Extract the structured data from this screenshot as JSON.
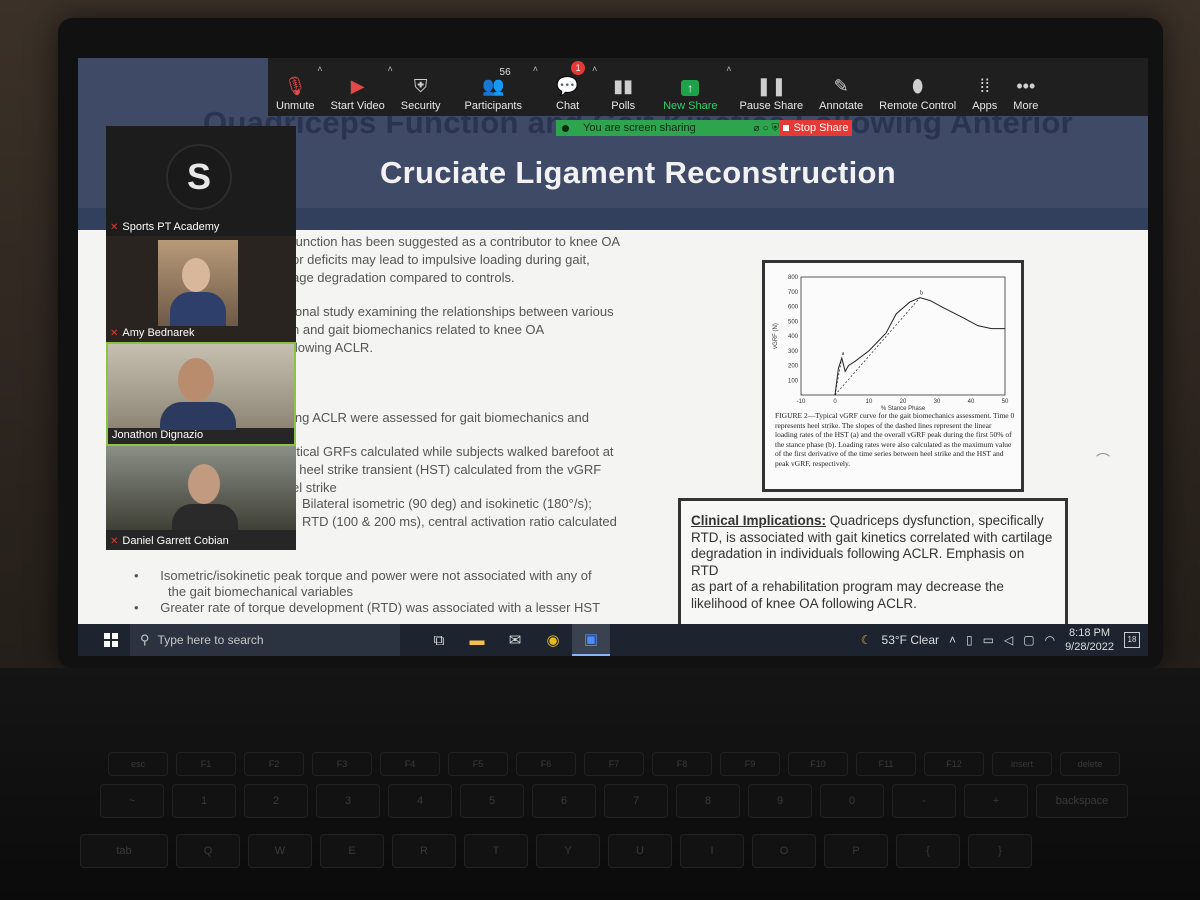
{
  "zoom": {
    "toolbar": [
      {
        "label": "Unmute",
        "icon": "mic-muted-icon"
      },
      {
        "label": "Start Video",
        "icon": "video-off-icon"
      },
      {
        "label": "Security",
        "icon": "shield-icon"
      },
      {
        "label": "Participants",
        "icon": "participants-icon",
        "count": "56"
      },
      {
        "label": "Chat",
        "icon": "chat-icon",
        "badge": "1"
      },
      {
        "label": "Polls",
        "icon": "polls-icon"
      },
      {
        "label": "New Share",
        "icon": "share-arrow-icon"
      },
      {
        "label": "Pause Share",
        "icon": "pause-icon"
      },
      {
        "label": "Annotate",
        "icon": "pen-icon"
      },
      {
        "label": "Remote Control",
        "icon": "mouse-icon"
      },
      {
        "label": "Apps",
        "icon": "apps-icon"
      },
      {
        "label": "More",
        "icon": "more-icon"
      }
    ],
    "sharing_banner": "You are screen sharing",
    "stop_share": "Stop Share",
    "participants": [
      {
        "name": "Sports PT Academy"
      },
      {
        "name": "Amy Bednarek"
      },
      {
        "name": "Jonathon Dignazio"
      },
      {
        "name": "Daniel Garrett Cobian"
      }
    ],
    "colors": {
      "share_green": "#2ea44f",
      "stop_red": "#e53935",
      "toolbar": "#1f1f1f"
    }
  },
  "slide": {
    "title_line1": "Quadriceps Function and Gait Kinetics Following Anterior",
    "title_line2": "Cruciate Ligament Reconstruction",
    "lines": [
      "function has been suggested as a contributor to knee OA",
      "or deficits may lead to impulsive loading during gait,",
      "age degradation compared to controls.",
      "ional study examining the relationships between various",
      "n and gait biomechanics related to knee OA",
      "llowing ACLR.",
      "ing ACLR were assessed for gait biomechanics and",
      "rtical GRFs calculated while subjects walked barefoot at",
      "; heel strike transient (HST) calculated from the vGRF",
      "el strike",
      "Bilateral isometric (90 deg) and isokinetic (180°/s);",
      "RTD (100 & 200 ms), central activation ratio calculated"
    ],
    "bullets": [
      "Isometric/isokinetic peak torque and power were not associated with any of",
      "the gait biomechanical variables",
      "Greater rate of torque development (RTD) was associated with a lesser HST"
    ],
    "clinical_heading": "Clinical Implications:",
    "clinical_lines": [
      " Quadriceps dysfunction, specifically",
      "RTD, is associated with gait kinetics correlated with cartilage",
      "degradation in individuals following ACLR. Emphasis on RTD",
      "as part of a rehabilitation program may decrease the",
      "likelihood of knee OA following ACLR."
    ],
    "figure": {
      "caption": "FIGURE 2—Typical vGRF curve for the gait biomechanics assessment. Time 0 represents heel strike. The slopes of the dashed lines represent the linear loading rates of the HST (a) and the overall vGRF peak during the first 50% of the stance phase (b). Loading rates were also calculated as the maximum value of the first derivative of the time series between heel strike and the HST and peak vGRF, respectively."
    }
  },
  "chart_data": {
    "type": "line",
    "xlabel": "% Stance Phase",
    "ylabel": "vGRF (N)",
    "xlim": [
      -10,
      50
    ],
    "ylim": [
      0,
      800
    ],
    "xticks": [
      "-10",
      "0",
      "10",
      "20",
      "30",
      "40",
      "50"
    ],
    "yticks": [
      "100",
      "200",
      "300",
      "400",
      "500",
      "600",
      "700",
      "800"
    ],
    "annotations": [
      "a",
      "b"
    ],
    "series": [
      {
        "x": [
          0,
          1,
          2,
          3,
          4,
          6,
          10,
          15,
          18,
          22,
          25,
          28,
          32,
          38,
          42,
          46,
          50
        ],
        "y": [
          0,
          180,
          250,
          160,
          200,
          230,
          300,
          420,
          550,
          630,
          660,
          640,
          590,
          520,
          470,
          450,
          450
        ]
      }
    ]
  },
  "taskbar": {
    "search_placeholder": "Type here to search",
    "weather": "53°F  Clear",
    "time": "8:18 PM",
    "date": "9/28/2022",
    "notifications": "18"
  }
}
